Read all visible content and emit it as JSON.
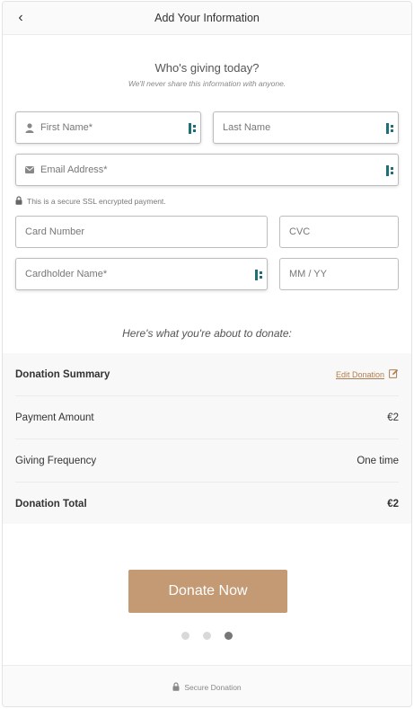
{
  "header": {
    "title": "Add Your Information",
    "back_icon": "chevron-left-icon",
    "back_glyph": "‹"
  },
  "intro": {
    "heading": "Who's giving today?",
    "subheading": "We'll never share this information with anyone."
  },
  "form": {
    "first_name": "First Name*",
    "last_name": "Last Name",
    "email": "Email Address*",
    "ssl_note": "This is a secure SSL encrypted payment.",
    "card_number": "Card Number",
    "cvc": "CVC",
    "cardholder": "Cardholder Name*",
    "expiry": "MM / YY",
    "user_icon": "user-icon",
    "mail_icon": "envelope-icon"
  },
  "summary": {
    "intro": "Here's what you're about to donate:",
    "title": "Donation Summary",
    "edit_label": "Edit Donation",
    "rows": [
      {
        "label": "Payment Amount",
        "value": "€2"
      },
      {
        "label": "Giving Frequency",
        "value": "One time"
      }
    ],
    "total_label": "Donation Total",
    "total_value": "€2"
  },
  "cta": {
    "label": "Donate Now"
  },
  "pager": {
    "count": 3,
    "active": 3
  },
  "footer": {
    "label": "Secure Donation"
  },
  "colors": {
    "accent": "#c49a74",
    "link": "#b07d4f",
    "badge": "#1f6f78"
  }
}
